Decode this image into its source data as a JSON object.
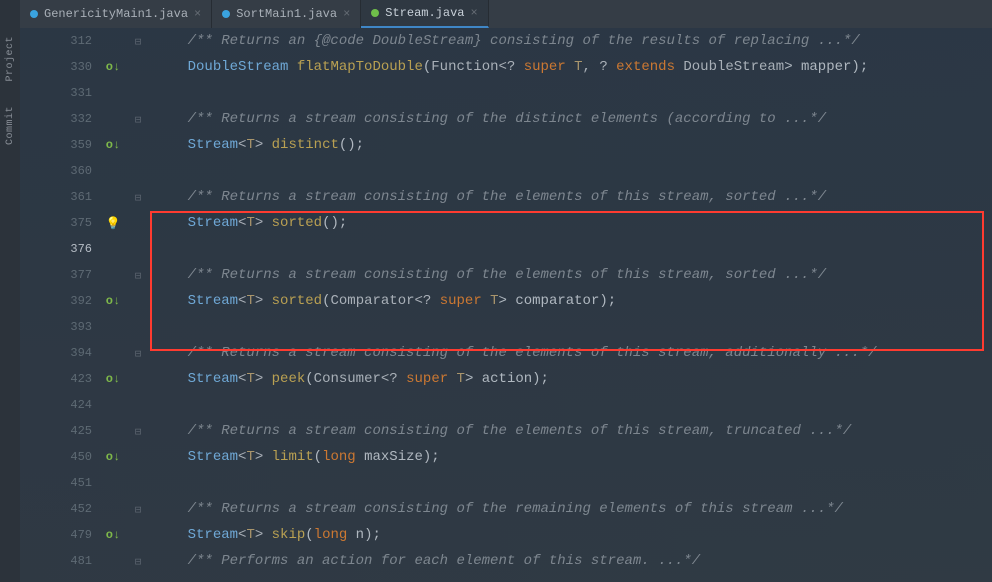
{
  "sidebar": {
    "items": [
      "Project",
      "Commit"
    ]
  },
  "tabs": [
    {
      "name": "GenericityMain1.java",
      "icon": "java-class",
      "iconColor": "blue",
      "active": false
    },
    {
      "name": "SortMain1.java",
      "icon": "java-class",
      "iconColor": "blue",
      "active": false
    },
    {
      "name": "Stream.java",
      "icon": "java-interface",
      "iconColor": "green",
      "active": true
    }
  ],
  "lines": [
    {
      "num": "312",
      "marker": "",
      "fold": "⊟",
      "tokens": [
        {
          "t": "    ",
          "c": ""
        },
        {
          "t": "/** Returns an {@code DoubleStream} consisting of the results of replacing ...*/",
          "c": "comment"
        }
      ]
    },
    {
      "num": "330",
      "marker": "O↓",
      "fold": "",
      "tokens": [
        {
          "t": "    ",
          "c": ""
        },
        {
          "t": "DoubleStream",
          "c": "type"
        },
        {
          "t": " ",
          "c": ""
        },
        {
          "t": "flatMapToDouble",
          "c": "method"
        },
        {
          "t": "(",
          "c": "punct"
        },
        {
          "t": "Function",
          "c": "param"
        },
        {
          "t": "<? ",
          "c": "angle"
        },
        {
          "t": "super",
          "c": "keyword"
        },
        {
          "t": " ",
          "c": ""
        },
        {
          "t": "T",
          "c": "gen"
        },
        {
          "t": ", ? ",
          "c": "angle"
        },
        {
          "t": "extends",
          "c": "keyword"
        },
        {
          "t": " ",
          "c": ""
        },
        {
          "t": "DoubleStream",
          "c": "param"
        },
        {
          "t": "> mapper);",
          "c": "punct"
        }
      ]
    },
    {
      "num": "331",
      "marker": "",
      "fold": "",
      "tokens": []
    },
    {
      "num": "332",
      "marker": "",
      "fold": "⊟",
      "tokens": [
        {
          "t": "    ",
          "c": ""
        },
        {
          "t": "/** Returns a stream consisting of the distinct elements (according to ...*/",
          "c": "comment"
        }
      ]
    },
    {
      "num": "359",
      "marker": "O↓",
      "fold": "",
      "tokens": [
        {
          "t": "    ",
          "c": ""
        },
        {
          "t": "Stream",
          "c": "type"
        },
        {
          "t": "<",
          "c": "angle"
        },
        {
          "t": "T",
          "c": "gen"
        },
        {
          "t": "> ",
          "c": "angle"
        },
        {
          "t": "distinct",
          "c": "method"
        },
        {
          "t": "();",
          "c": "punct"
        }
      ]
    },
    {
      "num": "360",
      "marker": "",
      "fold": "",
      "tokens": []
    },
    {
      "num": "361",
      "marker": "",
      "fold": "⊟",
      "tokens": [
        {
          "t": "    ",
          "c": ""
        },
        {
          "t": "/** Returns a stream consisting of the elements of this stream, sorted ...*/",
          "c": "comment"
        }
      ]
    },
    {
      "num": "375",
      "marker": "bulb",
      "fold": "",
      "tokens": [
        {
          "t": "    ",
          "c": ""
        },
        {
          "t": "Stream",
          "c": "type"
        },
        {
          "t": "<",
          "c": "angle"
        },
        {
          "t": "T",
          "c": "gen"
        },
        {
          "t": "> ",
          "c": "angle"
        },
        {
          "t": "sorted",
          "c": "method"
        },
        {
          "t": "();",
          "c": "punct"
        }
      ]
    },
    {
      "num": "376",
      "marker": "",
      "fold": "",
      "tokens": [],
      "cur": true
    },
    {
      "num": "377",
      "marker": "",
      "fold": "⊟",
      "tokens": [
        {
          "t": "    ",
          "c": ""
        },
        {
          "t": "/** Returns a stream consisting of the elements of this stream, sorted ...*/",
          "c": "comment"
        }
      ]
    },
    {
      "num": "392",
      "marker": "O↓",
      "fold": "",
      "tokens": [
        {
          "t": "    ",
          "c": ""
        },
        {
          "t": "Stream",
          "c": "type"
        },
        {
          "t": "<",
          "c": "angle"
        },
        {
          "t": "T",
          "c": "gen"
        },
        {
          "t": "> ",
          "c": "angle"
        },
        {
          "t": "sorted",
          "c": "method"
        },
        {
          "t": "(",
          "c": "punct"
        },
        {
          "t": "Comparator",
          "c": "param"
        },
        {
          "t": "<? ",
          "c": "angle"
        },
        {
          "t": "super",
          "c": "keyword"
        },
        {
          "t": " ",
          "c": ""
        },
        {
          "t": "T",
          "c": "gen"
        },
        {
          "t": "> comparator);",
          "c": "punct"
        }
      ]
    },
    {
      "num": "393",
      "marker": "",
      "fold": "",
      "tokens": []
    },
    {
      "num": "394",
      "marker": "",
      "fold": "⊟",
      "tokens": [
        {
          "t": "    ",
          "c": ""
        },
        {
          "t": "/** Returns a stream consisting of the elements of this stream, additionally ...*/",
          "c": "comment"
        }
      ]
    },
    {
      "num": "423",
      "marker": "O↓",
      "fold": "",
      "tokens": [
        {
          "t": "    ",
          "c": ""
        },
        {
          "t": "Stream",
          "c": "type"
        },
        {
          "t": "<",
          "c": "angle"
        },
        {
          "t": "T",
          "c": "gen"
        },
        {
          "t": "> ",
          "c": "angle"
        },
        {
          "t": "peek",
          "c": "method"
        },
        {
          "t": "(",
          "c": "punct"
        },
        {
          "t": "Consumer",
          "c": "param"
        },
        {
          "t": "<? ",
          "c": "angle"
        },
        {
          "t": "super",
          "c": "keyword"
        },
        {
          "t": " ",
          "c": ""
        },
        {
          "t": "T",
          "c": "gen"
        },
        {
          "t": "> action);",
          "c": "punct"
        }
      ]
    },
    {
      "num": "424",
      "marker": "",
      "fold": "",
      "tokens": []
    },
    {
      "num": "425",
      "marker": "",
      "fold": "⊟",
      "tokens": [
        {
          "t": "    ",
          "c": ""
        },
        {
          "t": "/** Returns a stream consisting of the elements of this stream, truncated ...*/",
          "c": "comment"
        }
      ]
    },
    {
      "num": "450",
      "marker": "O↓",
      "fold": "",
      "tokens": [
        {
          "t": "    ",
          "c": ""
        },
        {
          "t": "Stream",
          "c": "type"
        },
        {
          "t": "<",
          "c": "angle"
        },
        {
          "t": "T",
          "c": "gen"
        },
        {
          "t": "> ",
          "c": "angle"
        },
        {
          "t": "limit",
          "c": "method"
        },
        {
          "t": "(",
          "c": "punct"
        },
        {
          "t": "long",
          "c": "keyword"
        },
        {
          "t": " maxSize);",
          "c": "punct"
        }
      ]
    },
    {
      "num": "451",
      "marker": "",
      "fold": "",
      "tokens": []
    },
    {
      "num": "452",
      "marker": "",
      "fold": "⊟",
      "tokens": [
        {
          "t": "    ",
          "c": ""
        },
        {
          "t": "/** Returns a stream consisting of the remaining elements of this stream ...*/",
          "c": "comment"
        }
      ]
    },
    {
      "num": "479",
      "marker": "O↓",
      "fold": "",
      "tokens": [
        {
          "t": "    ",
          "c": ""
        },
        {
          "t": "Stream",
          "c": "type"
        },
        {
          "t": "<",
          "c": "angle"
        },
        {
          "t": "T",
          "c": "gen"
        },
        {
          "t": "> ",
          "c": "angle"
        },
        {
          "t": "skip",
          "c": "method"
        },
        {
          "t": "(",
          "c": "punct"
        },
        {
          "t": "long",
          "c": "keyword"
        },
        {
          "t": " n);",
          "c": "punct"
        }
      ]
    },
    {
      "num": "481",
      "marker": "",
      "fold": "⊟",
      "tokens": [
        {
          "t": "    ",
          "c": ""
        },
        {
          "t": "/** Performs an action for each element of this stream. ...*/",
          "c": "comment"
        }
      ]
    }
  ]
}
